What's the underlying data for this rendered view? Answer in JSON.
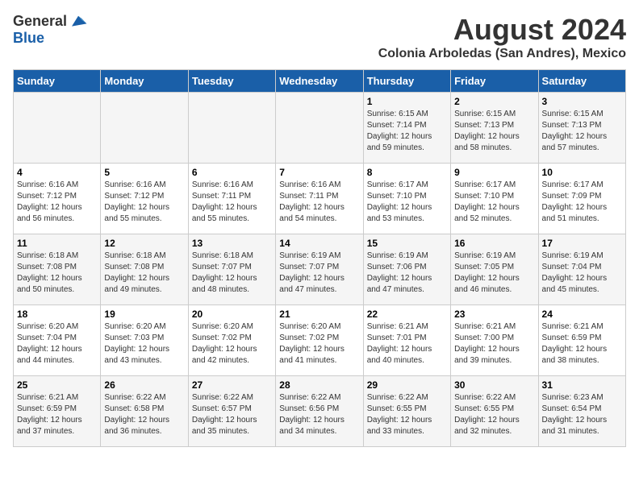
{
  "header": {
    "logo_general": "General",
    "logo_blue": "Blue",
    "month_title": "August 2024",
    "location": "Colonia Arboledas (San Andres), Mexico"
  },
  "weekdays": [
    "Sunday",
    "Monday",
    "Tuesday",
    "Wednesday",
    "Thursday",
    "Friday",
    "Saturday"
  ],
  "weeks": [
    [
      {
        "day": "",
        "sunrise": "",
        "sunset": "",
        "daylight": ""
      },
      {
        "day": "",
        "sunrise": "",
        "sunset": "",
        "daylight": ""
      },
      {
        "day": "",
        "sunrise": "",
        "sunset": "",
        "daylight": ""
      },
      {
        "day": "",
        "sunrise": "",
        "sunset": "",
        "daylight": ""
      },
      {
        "day": "1",
        "sunrise": "Sunrise: 6:15 AM",
        "sunset": "Sunset: 7:14 PM",
        "daylight": "Daylight: 12 hours and 59 minutes."
      },
      {
        "day": "2",
        "sunrise": "Sunrise: 6:15 AM",
        "sunset": "Sunset: 7:13 PM",
        "daylight": "Daylight: 12 hours and 58 minutes."
      },
      {
        "day": "3",
        "sunrise": "Sunrise: 6:15 AM",
        "sunset": "Sunset: 7:13 PM",
        "daylight": "Daylight: 12 hours and 57 minutes."
      }
    ],
    [
      {
        "day": "4",
        "sunrise": "Sunrise: 6:16 AM",
        "sunset": "Sunset: 7:12 PM",
        "daylight": "Daylight: 12 hours and 56 minutes."
      },
      {
        "day": "5",
        "sunrise": "Sunrise: 6:16 AM",
        "sunset": "Sunset: 7:12 PM",
        "daylight": "Daylight: 12 hours and 55 minutes."
      },
      {
        "day": "6",
        "sunrise": "Sunrise: 6:16 AM",
        "sunset": "Sunset: 7:11 PM",
        "daylight": "Daylight: 12 hours and 55 minutes."
      },
      {
        "day": "7",
        "sunrise": "Sunrise: 6:16 AM",
        "sunset": "Sunset: 7:11 PM",
        "daylight": "Daylight: 12 hours and 54 minutes."
      },
      {
        "day": "8",
        "sunrise": "Sunrise: 6:17 AM",
        "sunset": "Sunset: 7:10 PM",
        "daylight": "Daylight: 12 hours and 53 minutes."
      },
      {
        "day": "9",
        "sunrise": "Sunrise: 6:17 AM",
        "sunset": "Sunset: 7:10 PM",
        "daylight": "Daylight: 12 hours and 52 minutes."
      },
      {
        "day": "10",
        "sunrise": "Sunrise: 6:17 AM",
        "sunset": "Sunset: 7:09 PM",
        "daylight": "Daylight: 12 hours and 51 minutes."
      }
    ],
    [
      {
        "day": "11",
        "sunrise": "Sunrise: 6:18 AM",
        "sunset": "Sunset: 7:08 PM",
        "daylight": "Daylight: 12 hours and 50 minutes."
      },
      {
        "day": "12",
        "sunrise": "Sunrise: 6:18 AM",
        "sunset": "Sunset: 7:08 PM",
        "daylight": "Daylight: 12 hours and 49 minutes."
      },
      {
        "day": "13",
        "sunrise": "Sunrise: 6:18 AM",
        "sunset": "Sunset: 7:07 PM",
        "daylight": "Daylight: 12 hours and 48 minutes."
      },
      {
        "day": "14",
        "sunrise": "Sunrise: 6:19 AM",
        "sunset": "Sunset: 7:07 PM",
        "daylight": "Daylight: 12 hours and 47 minutes."
      },
      {
        "day": "15",
        "sunrise": "Sunrise: 6:19 AM",
        "sunset": "Sunset: 7:06 PM",
        "daylight": "Daylight: 12 hours and 47 minutes."
      },
      {
        "day": "16",
        "sunrise": "Sunrise: 6:19 AM",
        "sunset": "Sunset: 7:05 PM",
        "daylight": "Daylight: 12 hours and 46 minutes."
      },
      {
        "day": "17",
        "sunrise": "Sunrise: 6:19 AM",
        "sunset": "Sunset: 7:04 PM",
        "daylight": "Daylight: 12 hours and 45 minutes."
      }
    ],
    [
      {
        "day": "18",
        "sunrise": "Sunrise: 6:20 AM",
        "sunset": "Sunset: 7:04 PM",
        "daylight": "Daylight: 12 hours and 44 minutes."
      },
      {
        "day": "19",
        "sunrise": "Sunrise: 6:20 AM",
        "sunset": "Sunset: 7:03 PM",
        "daylight": "Daylight: 12 hours and 43 minutes."
      },
      {
        "day": "20",
        "sunrise": "Sunrise: 6:20 AM",
        "sunset": "Sunset: 7:02 PM",
        "daylight": "Daylight: 12 hours and 42 minutes."
      },
      {
        "day": "21",
        "sunrise": "Sunrise: 6:20 AM",
        "sunset": "Sunset: 7:02 PM",
        "daylight": "Daylight: 12 hours and 41 minutes."
      },
      {
        "day": "22",
        "sunrise": "Sunrise: 6:21 AM",
        "sunset": "Sunset: 7:01 PM",
        "daylight": "Daylight: 12 hours and 40 minutes."
      },
      {
        "day": "23",
        "sunrise": "Sunrise: 6:21 AM",
        "sunset": "Sunset: 7:00 PM",
        "daylight": "Daylight: 12 hours and 39 minutes."
      },
      {
        "day": "24",
        "sunrise": "Sunrise: 6:21 AM",
        "sunset": "Sunset: 6:59 PM",
        "daylight": "Daylight: 12 hours and 38 minutes."
      }
    ],
    [
      {
        "day": "25",
        "sunrise": "Sunrise: 6:21 AM",
        "sunset": "Sunset: 6:59 PM",
        "daylight": "Daylight: 12 hours and 37 minutes."
      },
      {
        "day": "26",
        "sunrise": "Sunrise: 6:22 AM",
        "sunset": "Sunset: 6:58 PM",
        "daylight": "Daylight: 12 hours and 36 minutes."
      },
      {
        "day": "27",
        "sunrise": "Sunrise: 6:22 AM",
        "sunset": "Sunset: 6:57 PM",
        "daylight": "Daylight: 12 hours and 35 minutes."
      },
      {
        "day": "28",
        "sunrise": "Sunrise: 6:22 AM",
        "sunset": "Sunset: 6:56 PM",
        "daylight": "Daylight: 12 hours and 34 minutes."
      },
      {
        "day": "29",
        "sunrise": "Sunrise: 6:22 AM",
        "sunset": "Sunset: 6:55 PM",
        "daylight": "Daylight: 12 hours and 33 minutes."
      },
      {
        "day": "30",
        "sunrise": "Sunrise: 6:22 AM",
        "sunset": "Sunset: 6:55 PM",
        "daylight": "Daylight: 12 hours and 32 minutes."
      },
      {
        "day": "31",
        "sunrise": "Sunrise: 6:23 AM",
        "sunset": "Sunset: 6:54 PM",
        "daylight": "Daylight: 12 hours and 31 minutes."
      }
    ]
  ]
}
